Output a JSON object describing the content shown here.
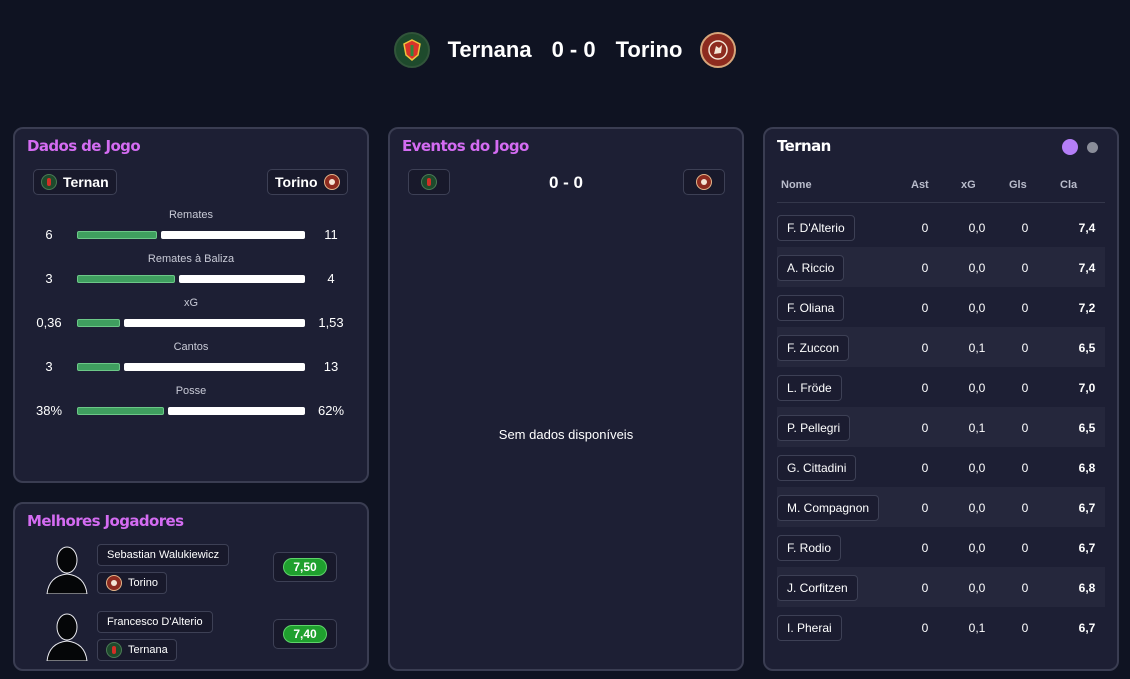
{
  "header": {
    "home": "Ternana",
    "score": "0 - 0",
    "away": "Torino"
  },
  "stats_panel": {
    "title": "Dados de Jogo",
    "home_chip": "Ternan",
    "away_chip": "Torino",
    "rows": [
      {
        "label": "Remates",
        "home": "6",
        "away": "11",
        "home_share": 0.35
      },
      {
        "label": "Remates à Baliza",
        "home": "3",
        "away": "4",
        "home_share": 0.43
      },
      {
        "label": "xG",
        "home": "0,36",
        "away": "1,53",
        "home_share": 0.19
      },
      {
        "label": "Cantos",
        "home": "3",
        "away": "13",
        "home_share": 0.19
      },
      {
        "label": "Posse",
        "home": "38%",
        "away": "62%",
        "home_share": 0.38
      }
    ]
  },
  "best_players": {
    "title": "Melhores Jogadores",
    "players": [
      {
        "name": "Sebastian Walukiewicz",
        "team": "Torino",
        "rating": "7,50"
      },
      {
        "name": "Francesco D'Alterio",
        "team": "Ternana",
        "rating": "7,40"
      }
    ]
  },
  "events": {
    "title": "Eventos do Jogo",
    "score": "0 - 0",
    "empty": "Sem dados disponíveis"
  },
  "lineup": {
    "title": "Ternan",
    "active_dot_color": "#b47ef7",
    "inactive_dot_color": "#8a8d99",
    "columns": [
      "Nome",
      "Ast",
      "xG",
      "Gls",
      "Cla"
    ],
    "rows": [
      {
        "name": "F. D'Alterio",
        "ast": "0",
        "xg": "0,0",
        "gls": "0",
        "cla": "7,4"
      },
      {
        "name": "A. Riccio",
        "ast": "0",
        "xg": "0,0",
        "gls": "0",
        "cla": "7,4"
      },
      {
        "name": "F. Oliana",
        "ast": "0",
        "xg": "0,0",
        "gls": "0",
        "cla": "7,2"
      },
      {
        "name": "F. Zuccon",
        "ast": "0",
        "xg": "0,1",
        "gls": "0",
        "cla": "6,5"
      },
      {
        "name": "L. Fröde",
        "ast": "0",
        "xg": "0,0",
        "gls": "0",
        "cla": "7,0"
      },
      {
        "name": "P. Pellegri",
        "ast": "0",
        "xg": "0,1",
        "gls": "0",
        "cla": "6,5"
      },
      {
        "name": "G. Cittadini",
        "ast": "0",
        "xg": "0,0",
        "gls": "0",
        "cla": "6,8"
      },
      {
        "name": "M. Compagnon",
        "ast": "0",
        "xg": "0,0",
        "gls": "0",
        "cla": "6,7"
      },
      {
        "name": "F. Rodio",
        "ast": "0",
        "xg": "0,0",
        "gls": "0",
        "cla": "6,7"
      },
      {
        "name": "J. Corfitzen",
        "ast": "0",
        "xg": "0,0",
        "gls": "0",
        "cla": "6,8"
      },
      {
        "name": "I. Pherai",
        "ast": "0",
        "xg": "0,1",
        "gls": "0",
        "cla": "6,7"
      }
    ]
  }
}
